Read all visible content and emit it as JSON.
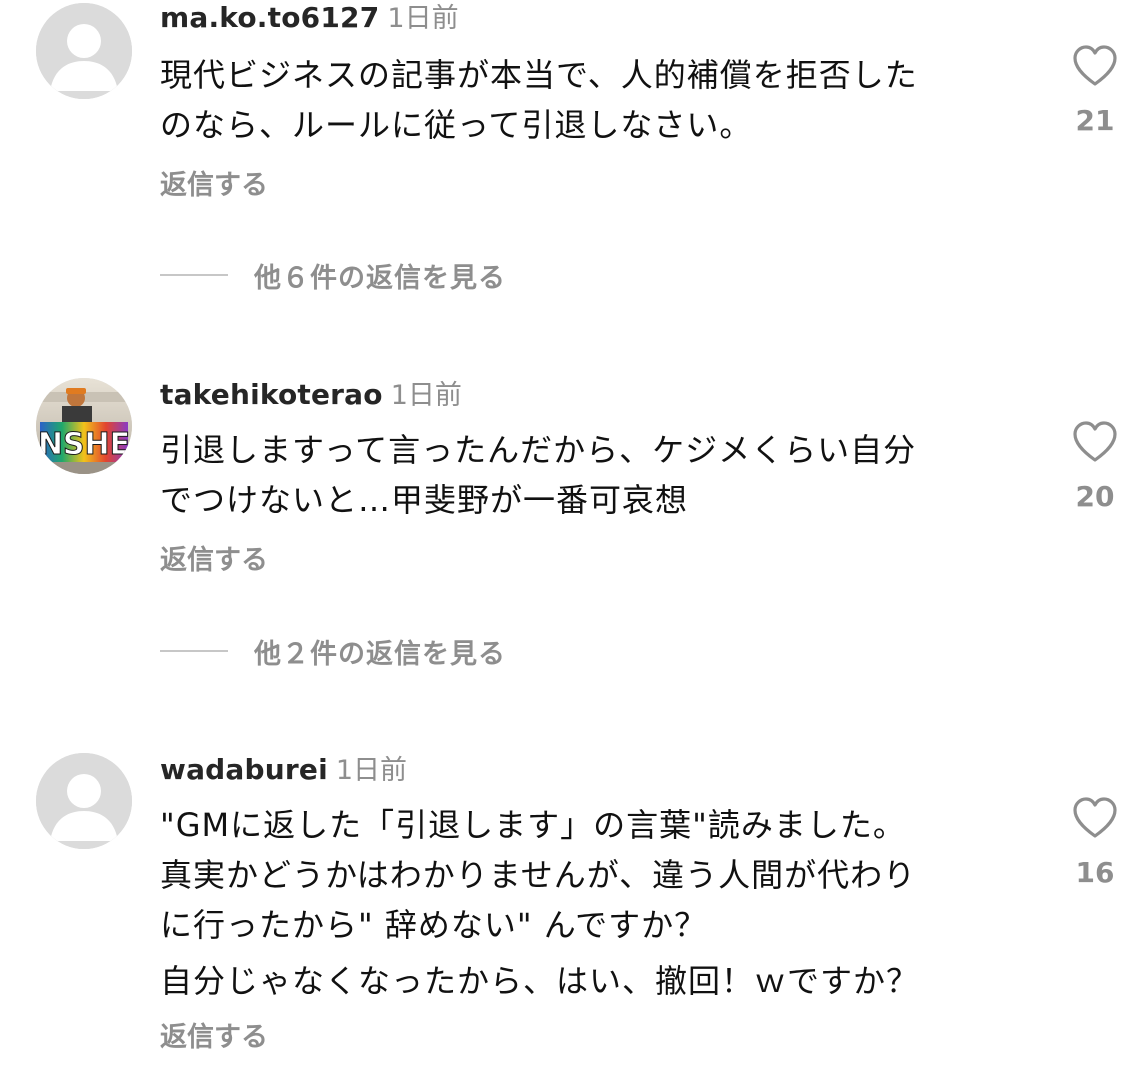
{
  "comments": [
    {
      "username": "ma.ko.to6127",
      "time": "1日前",
      "lines": [
        "現代ビジネスの記事が本当で、人的補償を拒否した",
        "のなら、ルールに従って引退しなさい。"
      ],
      "reply_label": "返信する",
      "view_replies": "他６件の返信を見る",
      "likes": "21",
      "avatar": "default-avatar-icon"
    },
    {
      "username": "takehikoterao",
      "time": "1日前",
      "lines": [
        "引退しますって言ったんだから、ケジメくらい自分",
        "でつけないと…甲斐野が一番可哀想"
      ],
      "reply_label": "返信する",
      "view_replies": "他２件の返信を見る",
      "likes": "20",
      "avatar": "profile-photo"
    },
    {
      "username": "wadaburei",
      "time": "1日前",
      "lines": [
        "\"GMに返した「引退します」の言葉\"読みました。",
        "真実かどうかはわかりませんが、違う人間が代わり",
        "に行ったから\" 辞めない\" んですか？"
      ],
      "lines2": [
        "自分じゃなくなったから、はい、撤回！ｗですか？"
      ],
      "reply_label": "返信する",
      "likes": "16",
      "avatar": "default-avatar-icon"
    }
  ],
  "colors": {
    "text": "#111111",
    "username": "#262626",
    "secondary": "#8e8e8e",
    "avatar_bg": "#dbdbdb",
    "divider": "#c7c7c7"
  }
}
